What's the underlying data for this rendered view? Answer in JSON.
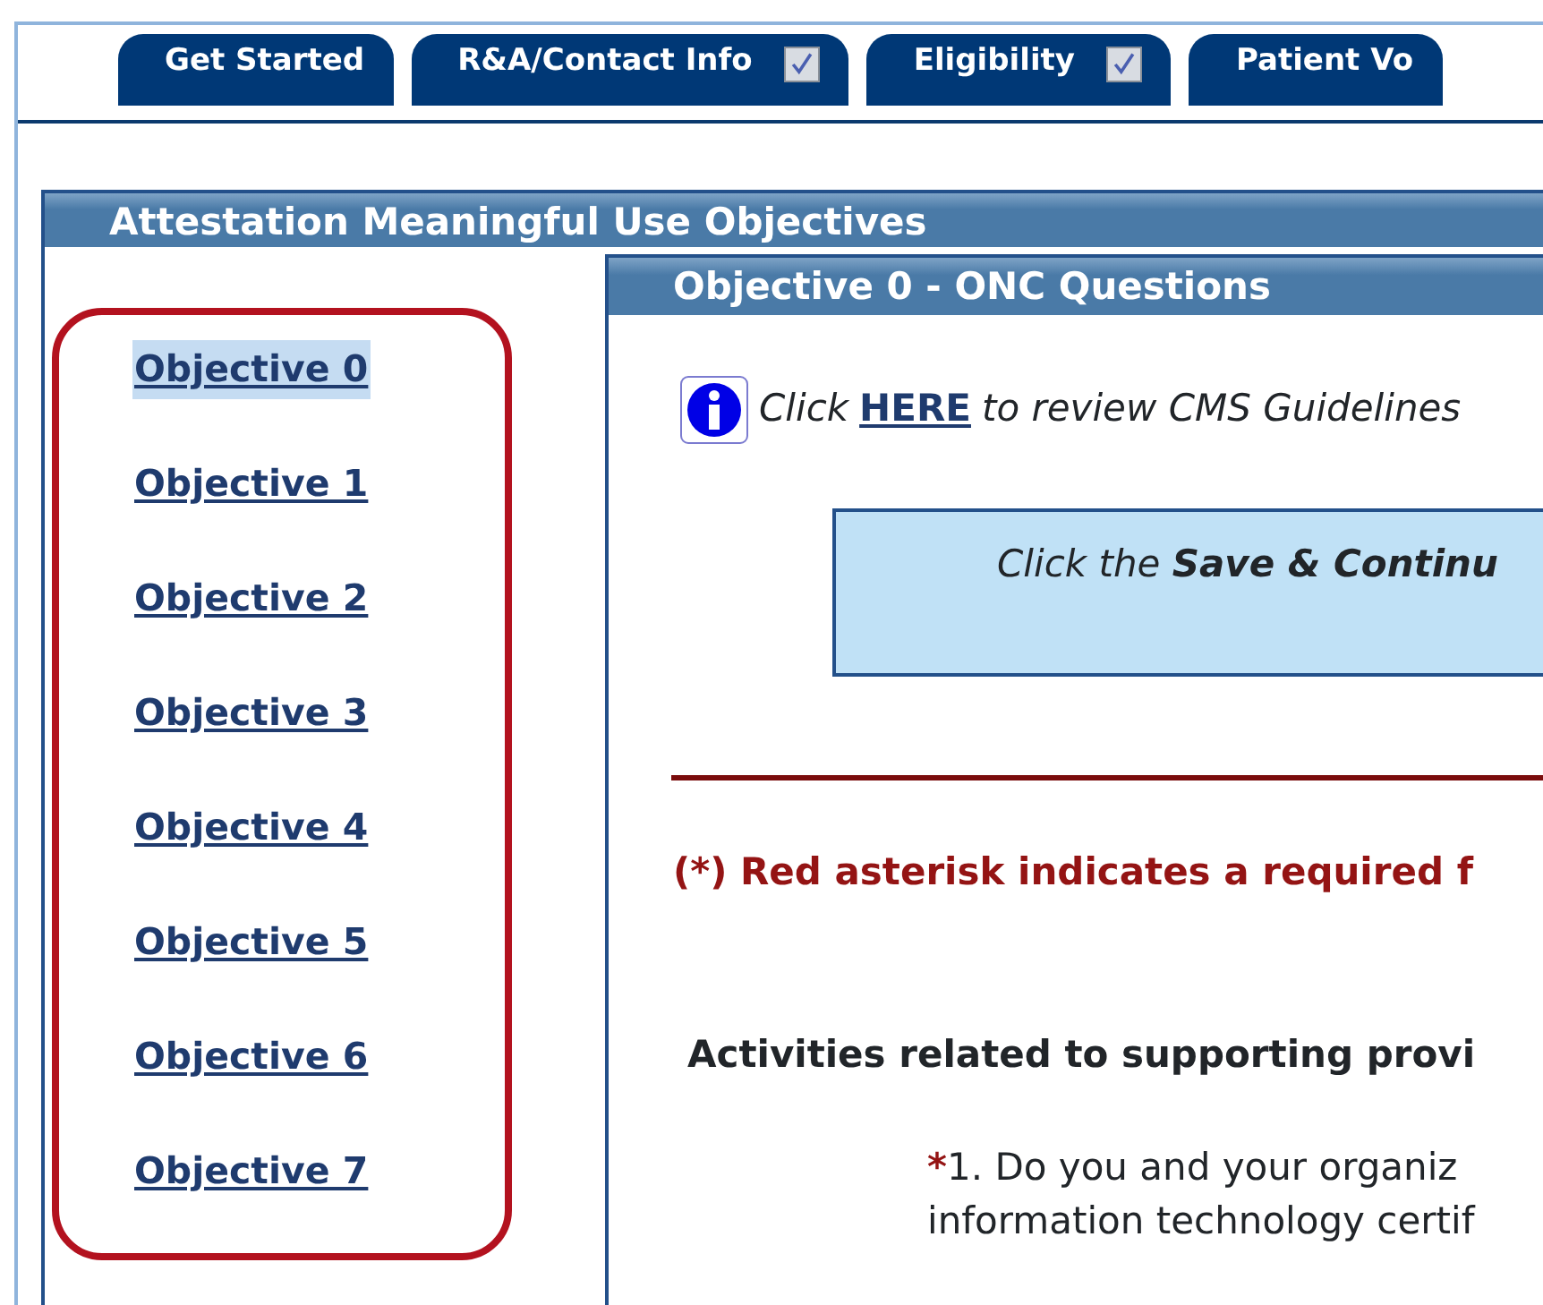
{
  "tabs": [
    {
      "label": "Get Started",
      "checked": false
    },
    {
      "label": "R&A/Contact Info",
      "checked": true
    },
    {
      "label": "Eligibility",
      "checked": true
    },
    {
      "label": "Patient Vo",
      "checked": false
    }
  ],
  "panel": {
    "title": "Attestation Meaningful Use Objectives"
  },
  "sidebar": {
    "items": [
      {
        "label": "Objective 0",
        "selected": true
      },
      {
        "label": "Objective 1",
        "selected": false
      },
      {
        "label": "Objective 2",
        "selected": false
      },
      {
        "label": "Objective 3",
        "selected": false
      },
      {
        "label": "Objective 4",
        "selected": false
      },
      {
        "label": "Objective 5",
        "selected": false
      },
      {
        "label": "Objective 6",
        "selected": false
      },
      {
        "label": "Objective 7",
        "selected": false
      }
    ]
  },
  "objective": {
    "title": "Objective 0 - ONC Questions",
    "info": {
      "before": "Click",
      "link": "HERE",
      "after": "to review CMS Guidelines"
    },
    "notice": "Click the **Save & Continu**",
    "required_note": "(*) Red asterisk indicates a required f",
    "section_heading": "Activities related to supporting provi",
    "questions": [
      {
        "required_mark": "*",
        "lines": [
          "1. Do you and your organiz",
          "information technology certif"
        ]
      }
    ]
  }
}
